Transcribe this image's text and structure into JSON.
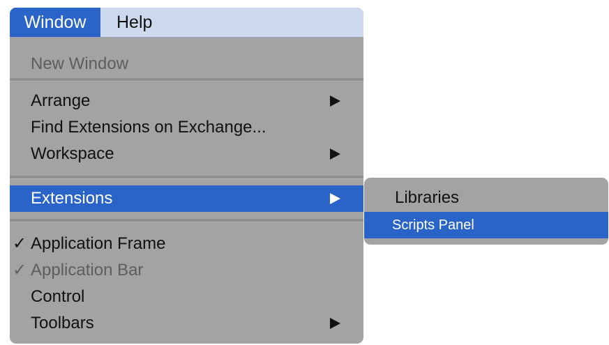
{
  "menubar": {
    "items": [
      {
        "label": "Window",
        "active": true
      },
      {
        "label": "Help",
        "active": false
      }
    ]
  },
  "window_menu": {
    "items": [
      {
        "label": "New Window",
        "enabled": false
      },
      {
        "label": "Arrange",
        "submenu": true
      },
      {
        "label": "Find Extensions on Exchange...",
        "submenu": false
      },
      {
        "label": "Workspace",
        "submenu": true
      },
      {
        "label": "Extensions",
        "submenu": true,
        "highlighted": true
      },
      {
        "label": "Application Frame",
        "checked": true
      },
      {
        "label": "Application Bar",
        "checked": true,
        "enabled": false
      },
      {
        "label": "Control"
      },
      {
        "label": "Toolbars",
        "submenu": true
      }
    ],
    "check_glyph": "✓"
  },
  "extensions_submenu": {
    "items": [
      {
        "label": "Libraries"
      },
      {
        "label": "Scripts Panel",
        "highlighted": true
      }
    ]
  },
  "colors": {
    "menu_bg": "#a3a3a3",
    "menubar_bg": "#cdd9ec",
    "highlight": "#2a64c8",
    "disabled_text": "#5e5e5e"
  }
}
